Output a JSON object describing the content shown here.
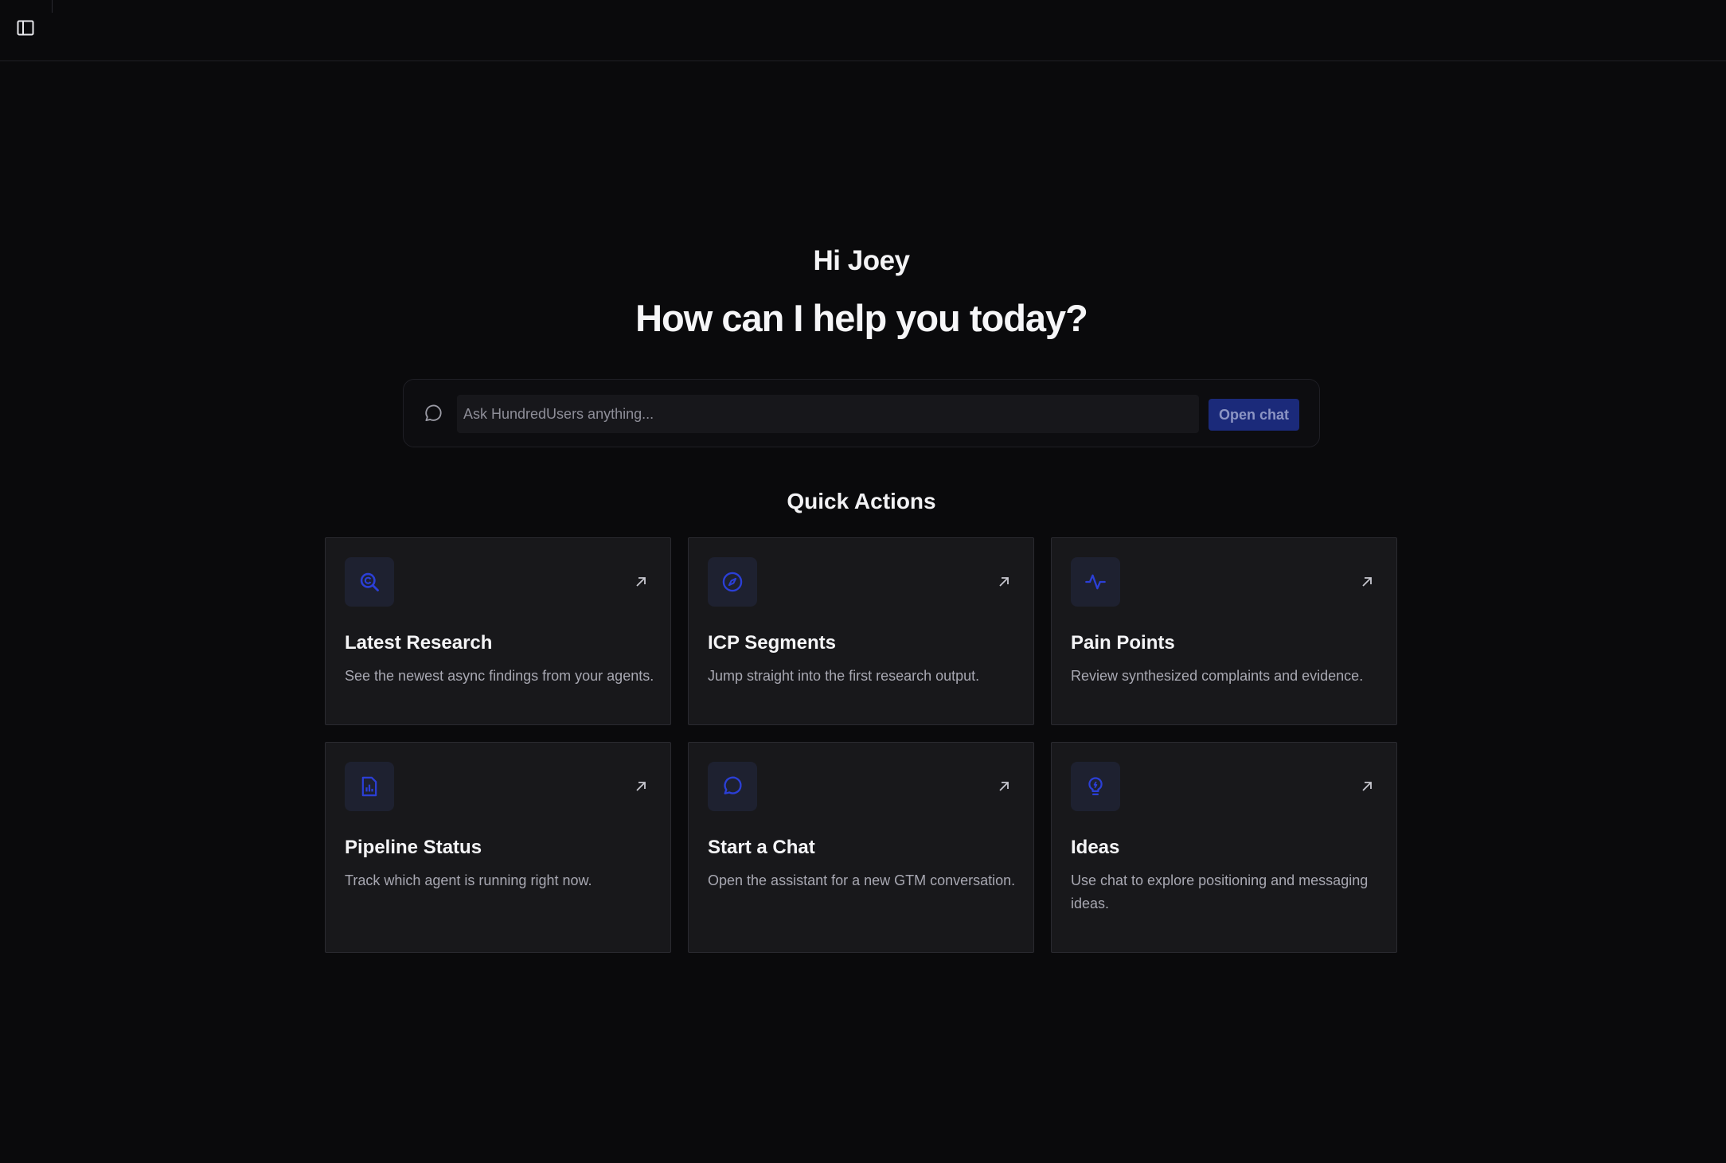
{
  "header": {
    "sidebar_toggle_icon": "panel-left-icon"
  },
  "hero": {
    "greeting": "Hi Joey",
    "headline": "How can I help you today?"
  },
  "chat": {
    "icon": "message-circle-icon",
    "placeholder": "Ask HundredUsers anything...",
    "value": "",
    "button_label": "Open chat"
  },
  "quick_actions": {
    "title": "Quick Actions",
    "cards": [
      {
        "title": "Latest Research",
        "description": "See the newest async findings from your agents.",
        "icon": "search-icon"
      },
      {
        "title": "ICP Segments",
        "description": "Jump straight into the first research output.",
        "icon": "compass-icon"
      },
      {
        "title": "Pain Points",
        "description": "Review synthesized complaints and evidence.",
        "icon": "activity-icon"
      },
      {
        "title": "Pipeline Status",
        "description": "Track which agent is running right now.",
        "icon": "file-chart-icon"
      },
      {
        "title": "Start a Chat",
        "description": "Open the assistant for a new GTM conversation.",
        "icon": "message-circle-icon"
      },
      {
        "title": "Ideas",
        "description": "Use chat to explore positioning and messaging ideas.",
        "icon": "lightbulb-icon"
      }
    ]
  },
  "colors": {
    "background": "#0a0a0c",
    "card": "#18181b",
    "accent": "#2b3fd6",
    "button": "#1b2a7a"
  }
}
